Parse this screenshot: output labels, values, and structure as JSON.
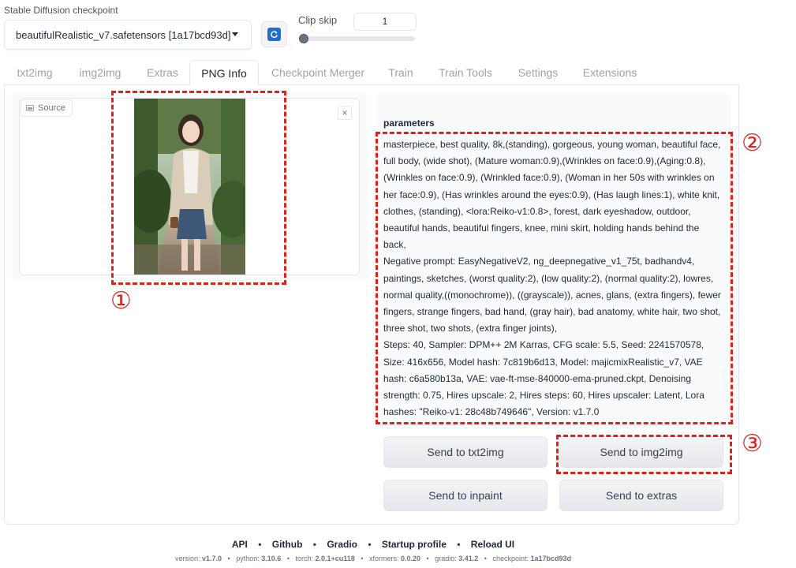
{
  "checkpoint": {
    "label": "Stable Diffusion checkpoint",
    "value": "beautifulRealistic_v7.safetensors [1a17bcd93d]"
  },
  "clip_skip": {
    "label": "Clip skip",
    "value": "1",
    "slider_fraction": 0
  },
  "tabs": [
    {
      "label": "txt2img"
    },
    {
      "label": "img2img"
    },
    {
      "label": "Extras"
    },
    {
      "label": "PNG Info"
    },
    {
      "label": "Checkpoint Merger"
    },
    {
      "label": "Train"
    },
    {
      "label": "Train Tools"
    },
    {
      "label": "Settings"
    },
    {
      "label": "Extensions"
    }
  ],
  "active_tab": "PNG Info",
  "source": {
    "label": "Source",
    "close": "×"
  },
  "parameters": {
    "label": "parameters",
    "prompt": "masterpiece, best quality, 8k,(standing), gorgeous, young woman, beautiful face, full body, (wide shot), (Mature woman:0.9),(Wrinkles on face:0.9),(Aging:0.8), (Wrinkles on face:0.9), (Wrinkled face:0.9), (Woman in her 50s with wrinkles on her face:0.9), (Has wrinkles around the eyes:0.9), (Has laugh lines:1), white knit, clothes, (standing), <lora:Reiko-v1:0.8>, forest, dark eyeshadow, outdoor, beautiful hands, beautiful fingers, knee, mini skirt, holding hands behind the back,",
    "negative": "Negative prompt: EasyNegativeV2, ng_deepnegative_v1_75t, badhandv4, paintings, sketches, (worst quality:2), (low quality:2), (normal quality:2), lowres, normal quality,((monochrome)), ((grayscale)), acnes, glans, (extra fingers), fewer fingers, strange fingers, bad hand, (gray hair), bad anatomy, white hair, two shot, three shot, two shots, (extra finger joints),",
    "settings": "Steps: 40, Sampler: DPM++ 2M Karras, CFG scale: 5.5, Seed: 2241570578, Size: 416x656, Model hash: 7c819b6d13, Model: majicmixRealistic_v7, VAE hash: c6a580b13a, VAE: vae-ft-mse-840000-ema-pruned.ckpt, Denoising strength: 0.75, Hires upscale: 2, Hires steps: 60, Hires upscaler: Latent, Lora hashes: \"Reiko-v1: 28c48b749646\", Version: v1.7.0"
  },
  "buttons": {
    "send_txt2img": "Send to txt2img",
    "send_img2img": "Send to img2img",
    "send_inpaint": "Send to inpaint",
    "send_extras": "Send to extras"
  },
  "annotations": {
    "one": "①",
    "two": "②",
    "three": "③",
    "color": "#e0201a"
  },
  "footer": {
    "links": [
      "API",
      "Github",
      "Gradio",
      "Startup profile",
      "Reload UI"
    ],
    "versions": [
      {
        "key": "version: ",
        "value": "v1.7.0"
      },
      {
        "key": "python: ",
        "value": "3.10.6"
      },
      {
        "key": "torch: ",
        "value": "2.0.1+cu118"
      },
      {
        "key": "xformers: ",
        "value": "0.0.20"
      },
      {
        "key": "gradio: ",
        "value": "3.41.2"
      },
      {
        "key": "checkpoint: ",
        "value": "1a17bcd93d"
      }
    ],
    "separator": "•"
  }
}
